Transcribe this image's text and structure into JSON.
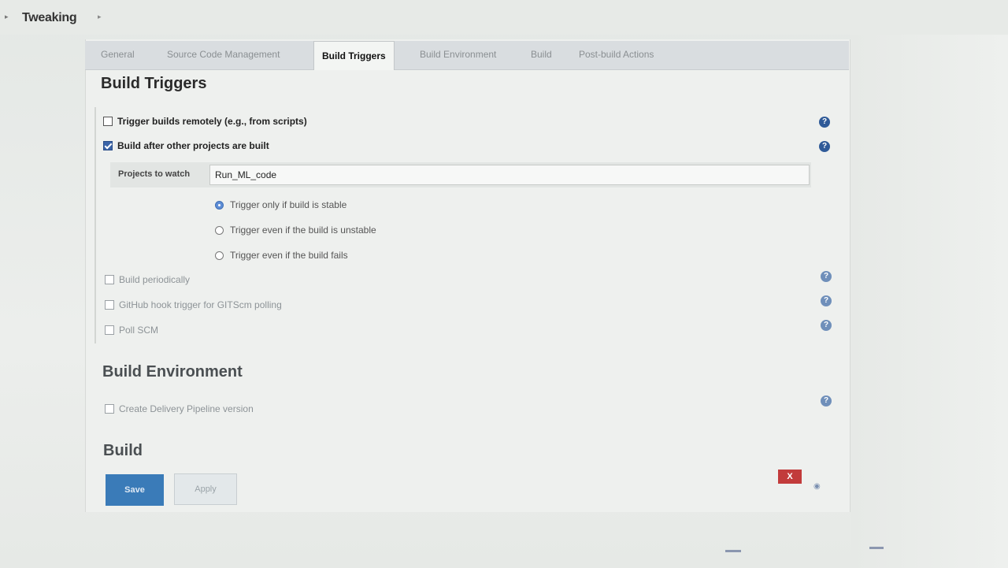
{
  "breadcrumb": {
    "title": "Tweaking"
  },
  "tabs": [
    {
      "label": "General",
      "active": false
    },
    {
      "label": "Source Code Management",
      "active": false
    },
    {
      "label": "Build Triggers",
      "active": true
    },
    {
      "label": "Build Environment",
      "active": false
    },
    {
      "label": "Build",
      "active": false
    },
    {
      "label": "Post-build Actions",
      "active": false
    }
  ],
  "build_triggers": {
    "title": "Build Triggers",
    "trigger_remotely": {
      "label": "Trigger builds remotely (e.g., from scripts)",
      "checked": false
    },
    "after_other_projects": {
      "label": "Build after other projects are built",
      "checked": true
    },
    "projects_to_watch": {
      "label": "Projects to watch",
      "value": "Run_ML_code"
    },
    "radio_options": [
      {
        "label": "Trigger only if build is stable",
        "selected": true
      },
      {
        "label": "Trigger even if the build is unstable",
        "selected": false
      },
      {
        "label": "Trigger even if the build fails",
        "selected": false
      }
    ],
    "build_periodically": {
      "label": "Build periodically",
      "checked": false
    },
    "github_hook": {
      "label": "GitHub hook trigger for GITScm polling",
      "checked": false
    },
    "poll_scm": {
      "label": "Poll SCM",
      "checked": false
    }
  },
  "build_environment": {
    "title": "Build Environment",
    "create_delivery_pipeline": {
      "label": "Create Delivery Pipeline version",
      "checked": false
    }
  },
  "build": {
    "title": "Build"
  },
  "buttons": {
    "save": "Save",
    "apply": "Apply",
    "delete": "X"
  },
  "icons": {
    "help": "help-icon",
    "delete": "delete-icon",
    "move": "move-handle-icon"
  },
  "colors": {
    "accent": "#3a7bb8",
    "help": "#2f5a98",
    "delete": "#c23b3b",
    "checkbox_checked": "#3a64a8"
  }
}
